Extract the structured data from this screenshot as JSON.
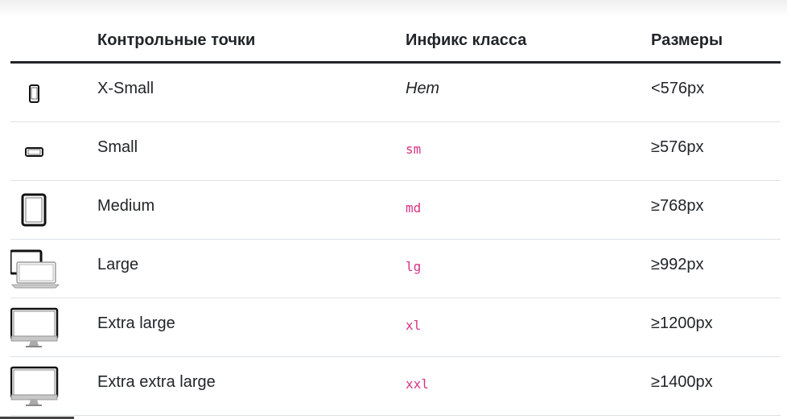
{
  "table": {
    "headers": {
      "breakpoints": "Контрольные точки",
      "class_infix": "Инфикс класса",
      "dimensions": "Размеры"
    },
    "rows": [
      {
        "icon": "phone-portrait-icon",
        "name": "X-Small",
        "infix": "Нет",
        "size": "<576px"
      },
      {
        "icon": "phone-landscape-icon",
        "name": "Small",
        "infix": "sm",
        "size": "≥576px"
      },
      {
        "icon": "tablet-icon",
        "name": "Medium",
        "infix": "md",
        "size": "≥768px"
      },
      {
        "icon": "laptop-icon",
        "name": "Large",
        "infix": "lg",
        "size": "≥992px"
      },
      {
        "icon": "desktop-monitor-icon",
        "name": "Extra large",
        "infix": "xl",
        "size": "≥1200px"
      },
      {
        "icon": "desktop-monitor-icon",
        "name": "Extra extra large",
        "infix": "xxl",
        "size": "≥1400px"
      }
    ]
  },
  "colors": {
    "text": "#212529",
    "code": "#d63384",
    "divider": "#dee2e6"
  }
}
